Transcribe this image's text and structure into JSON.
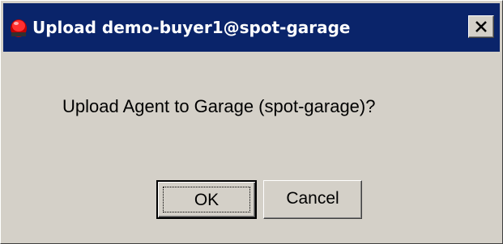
{
  "window": {
    "title": "Upload demo-buyer1@spot-garage",
    "close_glyph": "close-icon"
  },
  "dialog": {
    "message": "Upload Agent to Garage (spot-garage)?"
  },
  "buttons": {
    "ok_label": "OK",
    "cancel_label": "Cancel"
  },
  "colors": {
    "titlebar": "#0a246a",
    "dialog_background": "#d4d0c8",
    "title_text": "#ffffff"
  }
}
